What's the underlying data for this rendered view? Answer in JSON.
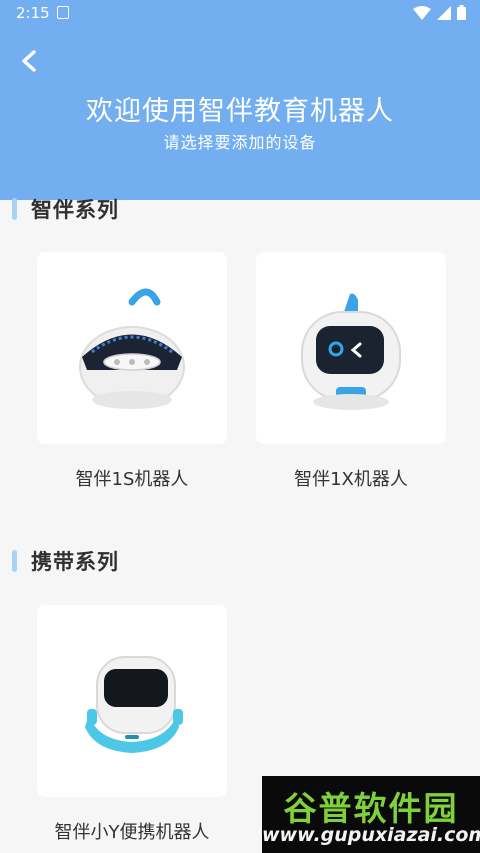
{
  "status_bar": {
    "time": "2:15"
  },
  "header": {
    "back_icon": "chevron-left-icon",
    "title": "欢迎使用智伴教育机器人",
    "subtitle": "请选择要添加的设备"
  },
  "sections": [
    {
      "title": "智伴系列",
      "devices": [
        {
          "label": "智伴1S机器人",
          "icon": "robot-1s-image"
        },
        {
          "label": "智伴1X机器人",
          "icon": "robot-1x-image"
        }
      ]
    },
    {
      "title": "携带系列",
      "devices": [
        {
          "label": "智伴小Y便携机器人",
          "icon": "robot-xiaoy-image"
        }
      ]
    }
  ],
  "watermark": {
    "title": "谷普软件园",
    "url": "www.gupuxiazai.com"
  },
  "colors": {
    "header_bg": "#72aef0",
    "section_bar": "#a9d3f5",
    "accent_blue": "#2ca3e8"
  }
}
